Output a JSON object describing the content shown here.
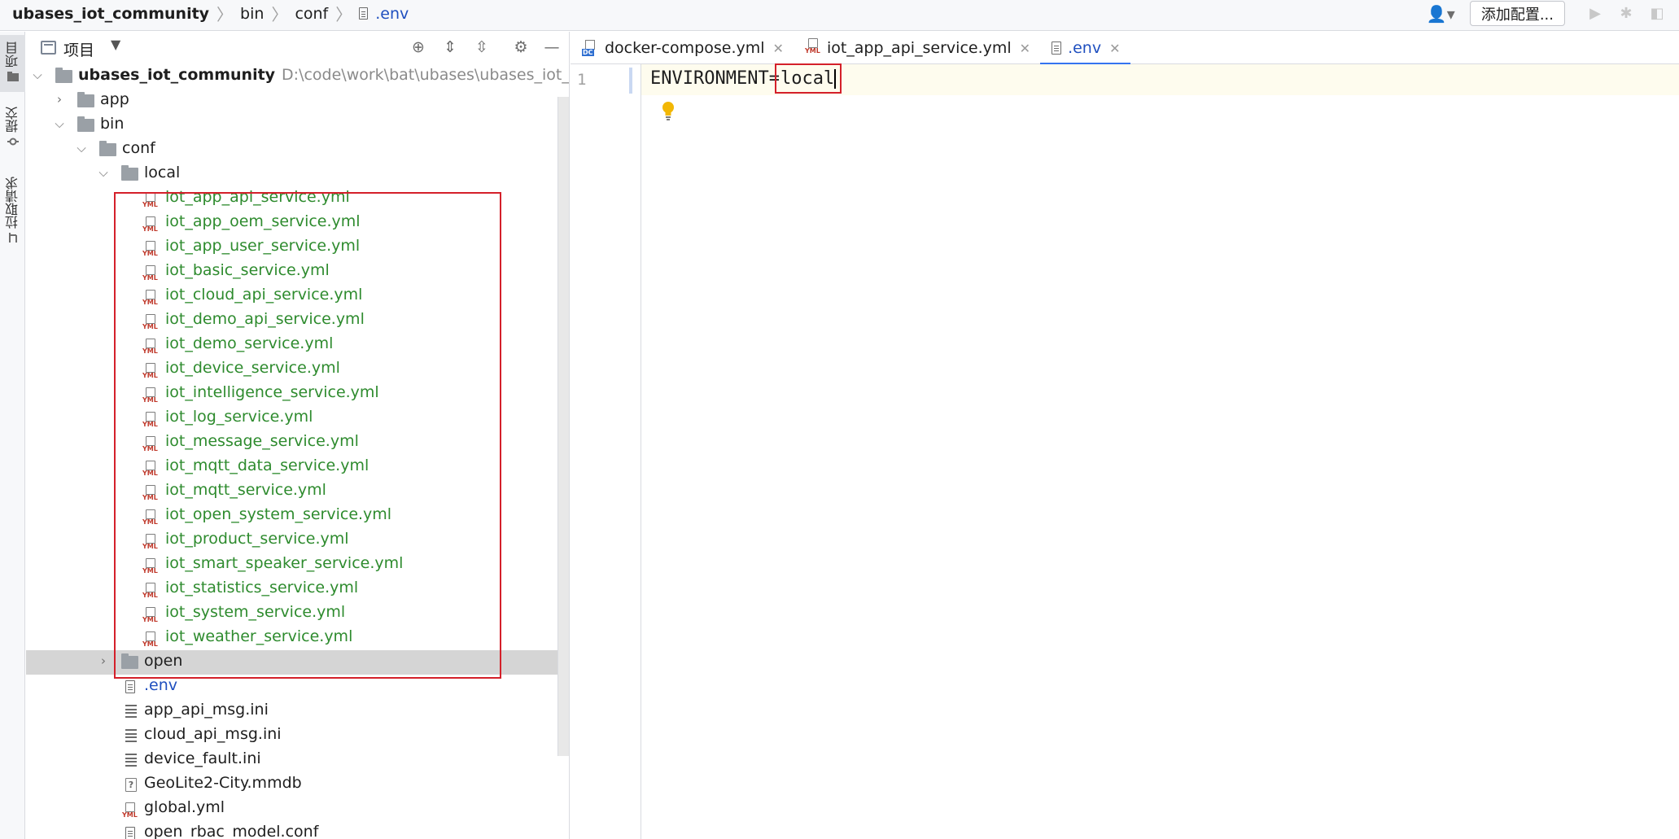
{
  "breadcrumb": {
    "project": "ubases_iot_community",
    "bin": "bin",
    "conf": "conf",
    "file": ".env"
  },
  "toolbar": {
    "add_config_label": "添加配置..."
  },
  "left_strip": {
    "project_tab": "项目",
    "commit_tab": "提交",
    "pull_request_tab": "拉取请求"
  },
  "panel": {
    "title": "项目"
  },
  "tree": {
    "root_name": "ubases_iot_community",
    "root_path": "D:\\code\\work\\bat\\ubases\\ubases_iot_community",
    "app": "app",
    "bin": "bin",
    "conf": "conf",
    "local": "local",
    "local_files": [
      "iot_app_api_service.yml",
      "iot_app_oem_service.yml",
      "iot_app_user_service.yml",
      "iot_basic_service.yml",
      "iot_cloud_api_service.yml",
      "iot_demo_api_service.yml",
      "iot_demo_service.yml",
      "iot_device_service.yml",
      "iot_intelligence_service.yml",
      "iot_log_service.yml",
      "iot_message_service.yml",
      "iot_mqtt_data_service.yml",
      "iot_mqtt_service.yml",
      "iot_open_system_service.yml",
      "iot_product_service.yml",
      "iot_smart_speaker_service.yml",
      "iot_statistics_service.yml",
      "iot_system_service.yml",
      "iot_weather_service.yml"
    ],
    "open": "open",
    "conf_files": [
      {
        "name": ".env",
        "type": "env"
      },
      {
        "name": "app_api_msg.ini",
        "type": "ini"
      },
      {
        "name": "cloud_api_msg.ini",
        "type": "ini"
      },
      {
        "name": "device_fault.ini",
        "type": "ini"
      },
      {
        "name": "GeoLite2-City.mmdb",
        "type": "unknown"
      },
      {
        "name": "global.yml",
        "type": "yml"
      },
      {
        "name": "open_rbac_model.conf",
        "type": "env"
      }
    ]
  },
  "editor": {
    "tabs": [
      {
        "label": "docker-compose.yml",
        "icon": "docker-compose-icon"
      },
      {
        "label": "iot_app_api_service.yml",
        "icon": "yml-icon"
      },
      {
        "label": ".env",
        "icon": "env-file-icon"
      }
    ],
    "line_number": "1",
    "code_key": "ENVIRONMENT=",
    "code_value": "local"
  },
  "colors": {
    "tree_green": "#2e8b2e",
    "link_blue": "#1f4fbf",
    "highlight_red": "#d4202a",
    "tab_underline": "#3574f0"
  }
}
